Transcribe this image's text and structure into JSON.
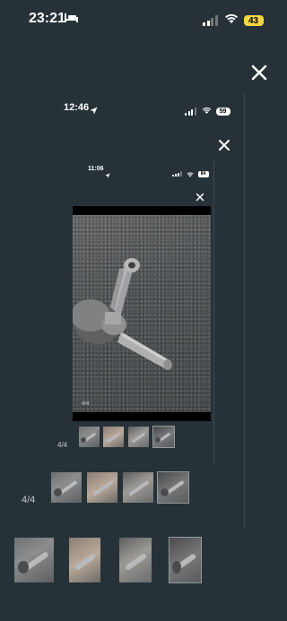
{
  "outer": {
    "status_bar": {
      "time": "23:21",
      "battery": "43"
    },
    "counter": "4/4"
  },
  "middle": {
    "status_bar": {
      "time": "12:46",
      "battery": "59"
    },
    "counter": "4/4"
  },
  "inner": {
    "status_bar": {
      "time": "11:06",
      "battery": "84"
    },
    "counter": "4/4",
    "photo_counter": "4/4"
  },
  "colors": {
    "background": "#263238",
    "battery_yellow": "#f5d547",
    "battery_white": "#ffffff"
  },
  "icons": [
    "bed-icon",
    "location-arrow-icon",
    "signal-icon",
    "wifi-icon",
    "battery-icon",
    "close-icon"
  ]
}
